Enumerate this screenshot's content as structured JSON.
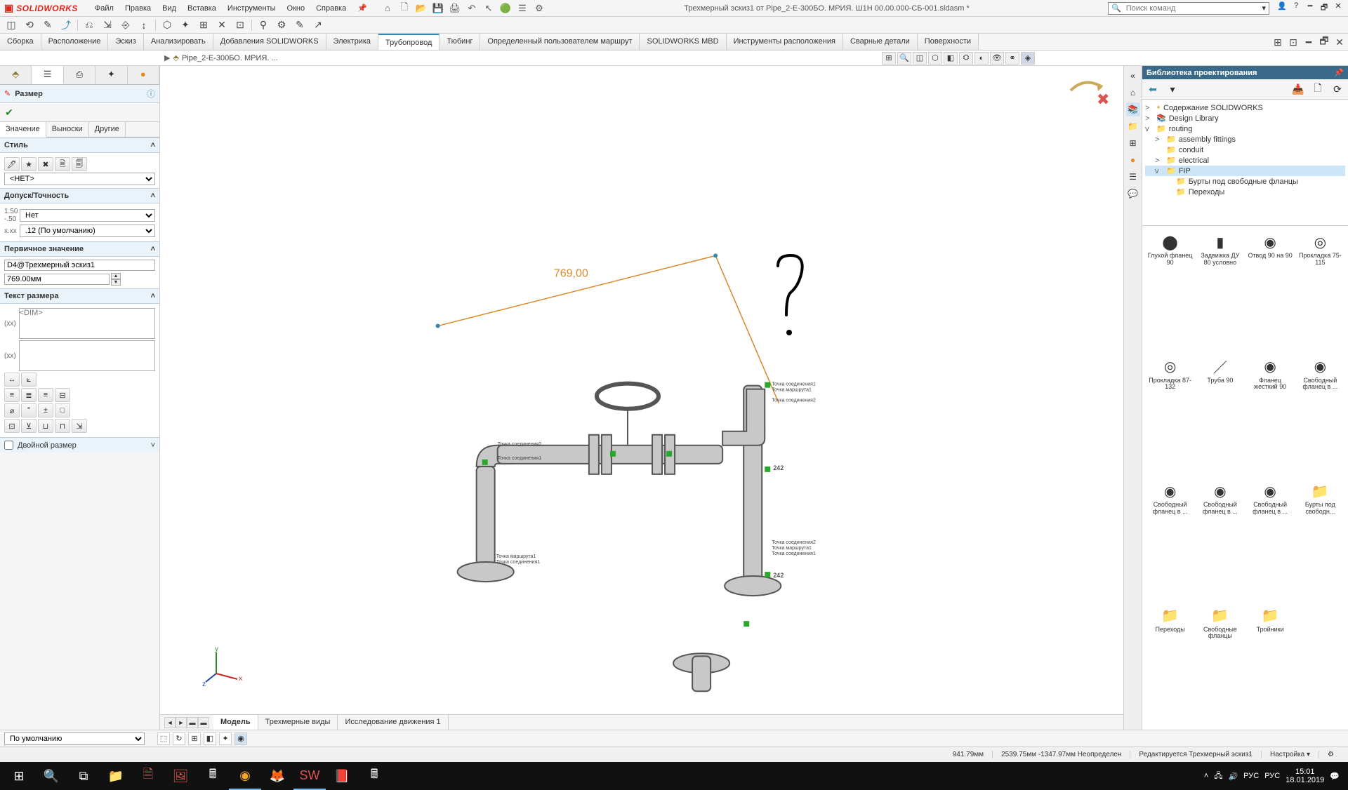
{
  "app": {
    "logo_text": "SOLIDWORKS",
    "doc_title": "Трехмерный эскиз1 от Pipe_2-E-300БО. МРИЯ. Ш1Н 00.00.000-СБ-001.sldasm *",
    "search_placeholder": "Поиск команд"
  },
  "menu": [
    "Файл",
    "Правка",
    "Вид",
    "Вставка",
    "Инструменты",
    "Окно",
    "Справка"
  ],
  "ribbon_tabs": [
    "Сборка",
    "Расположение",
    "Эскиз",
    "Анализировать",
    "Добавления SOLIDWORKS",
    "Электрика",
    "Трубопровод",
    "Тюбинг",
    "Определенный пользователем маршрут",
    "SOLIDWORKS MBD",
    "Инструменты расположения",
    "Сварные детали",
    "Поверхности"
  ],
  "ribbon_active": "Трубопровод",
  "breadcrumb": "Pipe_2-E-300БО. МРИЯ. ...",
  "prop": {
    "title": "Размер",
    "tabs": [
      "Значение",
      "Выноски",
      "Другие"
    ],
    "active_tab": "Значение",
    "style": {
      "header": "Стиль",
      "preset": "<НЕT>"
    },
    "tol": {
      "header": "Допуск/Точность",
      "val1": "Нет",
      "val2": ".12 (По умолчанию)"
    },
    "prim": {
      "header": "Первичное значение",
      "name": "D4@Трехмерный эскиз1",
      "val": "769.00мм"
    },
    "dtext": {
      "header": "Текст размера",
      "placeholder": "<DIM>"
    },
    "dual": "Двойной размер"
  },
  "viewport": {
    "dim_label": "769,00",
    "bottom_tabs": [
      "Модель",
      "Трехмерные виды",
      "Исследование движения 1"
    ],
    "active_bottom": "Модель"
  },
  "util": {
    "preset": "По умолчанию"
  },
  "rp": {
    "title": "Библиотека проектирования",
    "tree": [
      {
        "lvl": 0,
        "chev": ">",
        "icon": "⭑",
        "label": "Содержание SOLIDWORKS"
      },
      {
        "lvl": 0,
        "chev": ">",
        "icon": "📚",
        "label": "Design Library"
      },
      {
        "lvl": 0,
        "chev": "v",
        "icon": "📁",
        "label": "routing"
      },
      {
        "lvl": 1,
        "chev": ">",
        "icon": "📁",
        "label": "assembly fittings"
      },
      {
        "lvl": 1,
        "chev": "",
        "icon": "📁",
        "label": "conduit"
      },
      {
        "lvl": 1,
        "chev": ">",
        "icon": "📁",
        "label": "electrical"
      },
      {
        "lvl": 1,
        "chev": "v",
        "icon": "📁",
        "label": "FIP",
        "sel": true
      },
      {
        "lvl": 2,
        "chev": "",
        "icon": "📁",
        "label": "Бурты под свободные фланцы"
      },
      {
        "lvl": 2,
        "chev": "",
        "icon": "📁",
        "label": "Переходы"
      }
    ],
    "thumbs": [
      {
        "icon": "⬤",
        "label": "Глухой фланец 90"
      },
      {
        "icon": "▮",
        "label": "Задвижка ДУ 80 условно"
      },
      {
        "icon": "◉",
        "label": "Отвод 90 на 90"
      },
      {
        "icon": "◎",
        "label": "Прокладка 75-115"
      },
      {
        "icon": "◎",
        "label": "Прокладка 87-132"
      },
      {
        "icon": "／",
        "label": "Труба 90"
      },
      {
        "icon": "◉",
        "label": "Фланец жесткий 90"
      },
      {
        "icon": "◉",
        "label": "Свободный фланец в ..."
      },
      {
        "icon": "◉",
        "label": "Свободный фланец в ..."
      },
      {
        "icon": "◉",
        "label": "Свободный фланец в ..."
      },
      {
        "icon": "◉",
        "label": "Свободный фланец в ..."
      },
      {
        "icon": "📁",
        "label": "Бурты под свободн..."
      },
      {
        "icon": "📁",
        "label": "Переходы"
      },
      {
        "icon": "📁",
        "label": "Свободные фланцы"
      },
      {
        "icon": "📁",
        "label": "Тройники"
      }
    ]
  },
  "status": {
    "len": "941.79мм",
    "coords": "2539.75мм -1347.97мм Неопределен",
    "edit": "Редактируется Трехмерный эскиз1",
    "custom": "Настройка"
  },
  "taskbar": {
    "time": "15:01",
    "date": "18.01.2019",
    "kb1": "РУС",
    "kb2": "РУС"
  }
}
